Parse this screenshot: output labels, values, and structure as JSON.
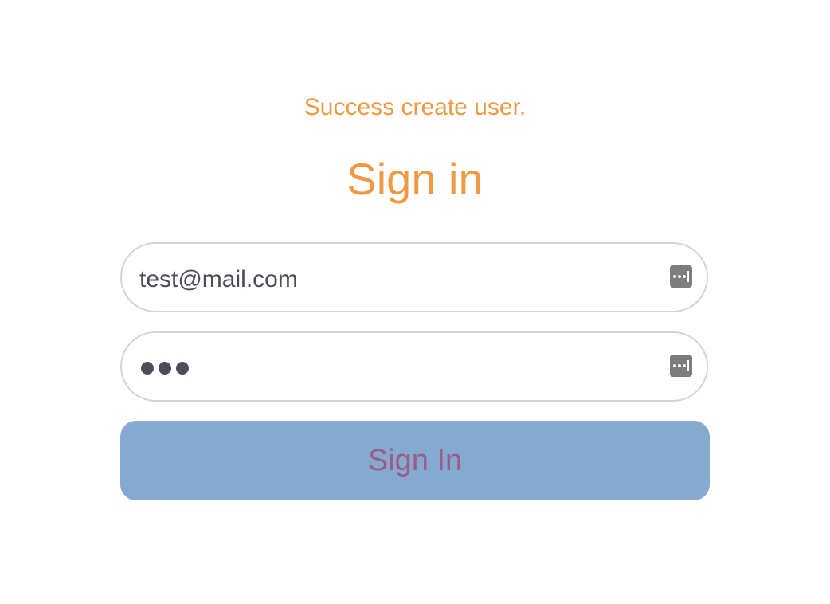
{
  "status_message": "Success create user.",
  "title": "Sign in",
  "email_field": {
    "value": "test@mail.com",
    "icon": "password-manager-key-icon"
  },
  "password_field": {
    "masked_length": 3,
    "icon": "password-manager-key-icon"
  },
  "submit_button": {
    "label": "Sign In"
  },
  "colors": {
    "accent": "#ef9a42",
    "button_bg": "#86aacf",
    "button_text": "#9a5e8c",
    "field_border": "#d3d4d8",
    "field_text": "#4a4e57"
  }
}
